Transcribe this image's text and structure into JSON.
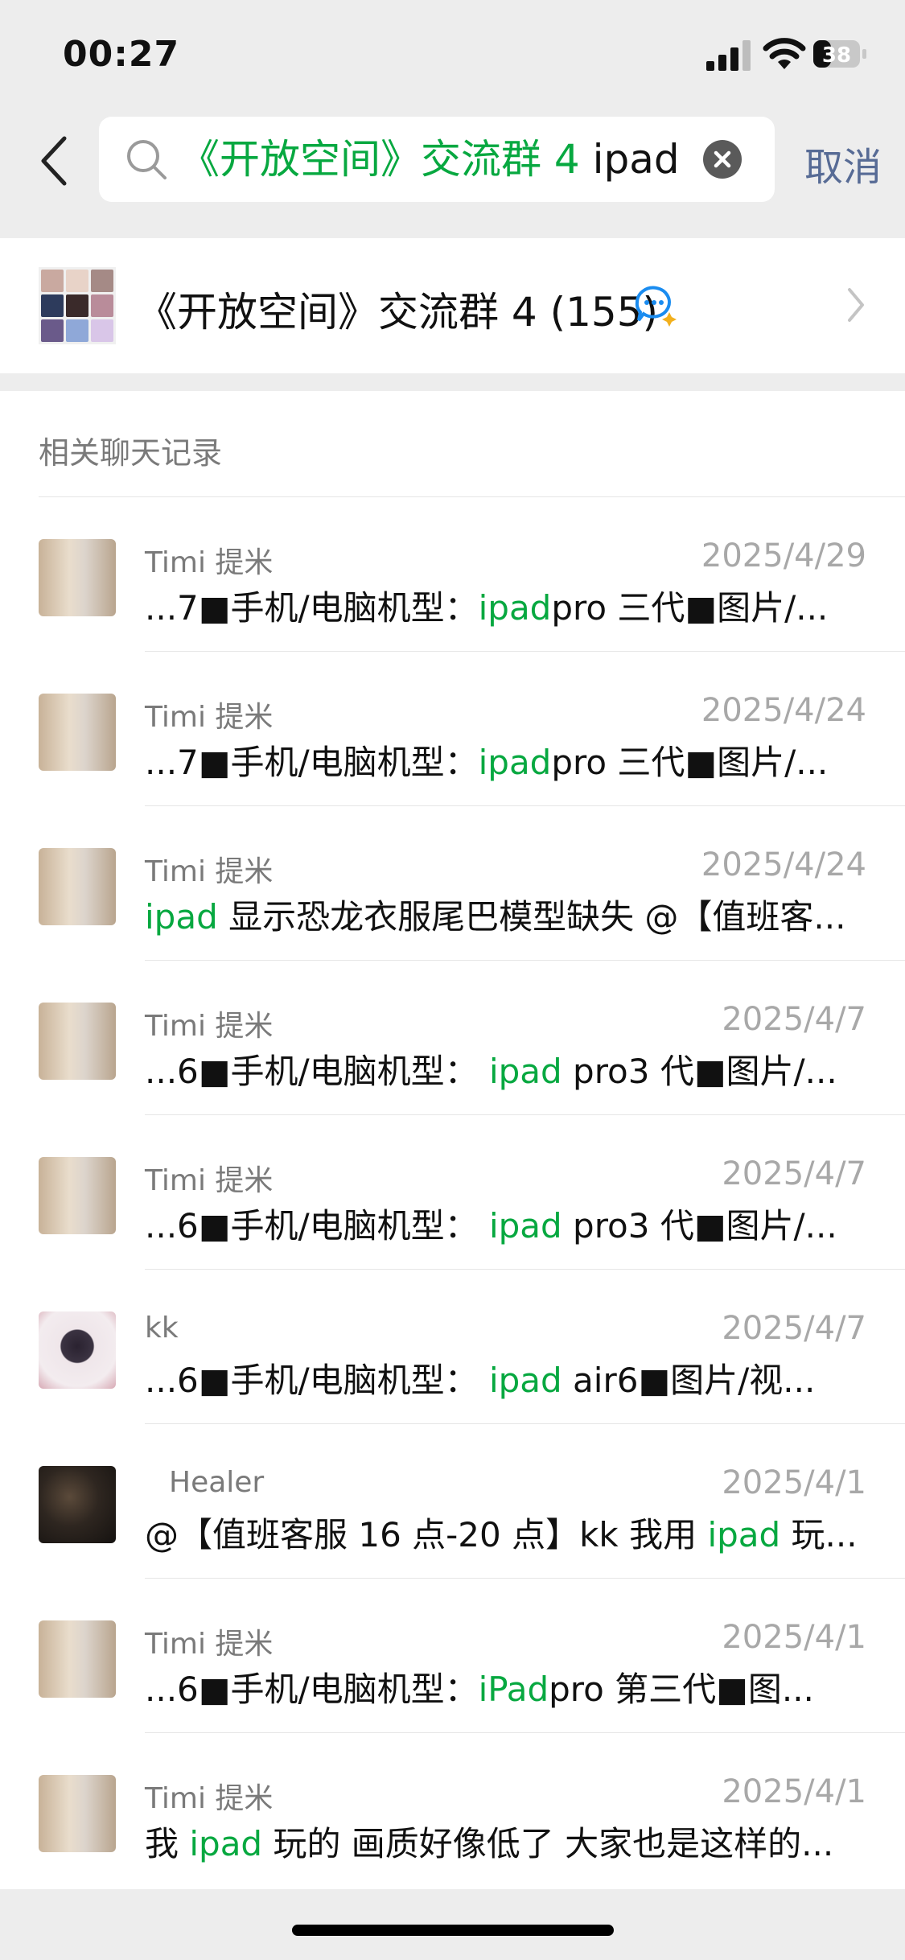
{
  "status_bar": {
    "time": "00:27",
    "battery": "38"
  },
  "search": {
    "query_green": "《开放空间》交流群 4",
    "query_dark": " ipad",
    "cancel_label": "取消"
  },
  "group": {
    "title": "《开放空间》交流群 4 (155)"
  },
  "records": {
    "header": "相关聊天记录",
    "items": [
      {
        "name": "Timi 提米",
        "date": "2025/4/29",
        "pre": "...7■手机/电脑机型：",
        "hl": "ipad",
        "post": "pro 三代■图片/..."
      },
      {
        "name": "Timi 提米",
        "date": "2025/4/24",
        "pre": "...7■手机/电脑机型：",
        "hl": "ipad",
        "post": "pro 三代■图片/..."
      },
      {
        "name": "Timi 提米",
        "date": "2025/4/24",
        "pre": "",
        "hl": "ipad",
        "post": " 显示恐龙衣服尾巴模型缺失 @【值班客..."
      },
      {
        "name": "Timi 提米",
        "date": "2025/4/7",
        "pre": "...6■手机/电脑机型： ",
        "hl": "ipad",
        "post": " pro3 代■图片/..."
      },
      {
        "name": "Timi 提米",
        "date": "2025/4/7",
        "pre": "...6■手机/电脑机型： ",
        "hl": "ipad",
        "post": " pro3 代■图片/..."
      },
      {
        "name": "kk",
        "date": "2025/4/7",
        "pre": "...6■手机/电脑机型： ",
        "hl": "ipad",
        "post": " air6■图片/视..."
      },
      {
        "name": "Healer",
        "date": "2025/4/1",
        "pre": "@【值班客服 16 点-20 点】kk 我用 ",
        "hl": "ipad",
        "post": " 玩..."
      },
      {
        "name": "Timi 提米",
        "date": "2025/4/1",
        "pre": "...6■手机/电脑机型：",
        "hl": "iPad",
        "post": "pro 第三代■图..."
      },
      {
        "name": "Timi 提米",
        "date": "2025/4/1",
        "pre": "我 ",
        "hl": "ipad",
        "post": " 玩的 画质好像低了 大家也是这样的..."
      }
    ]
  },
  "colors": {
    "highlight": "#07a840",
    "link": "#576b95",
    "background": "#ededed"
  }
}
